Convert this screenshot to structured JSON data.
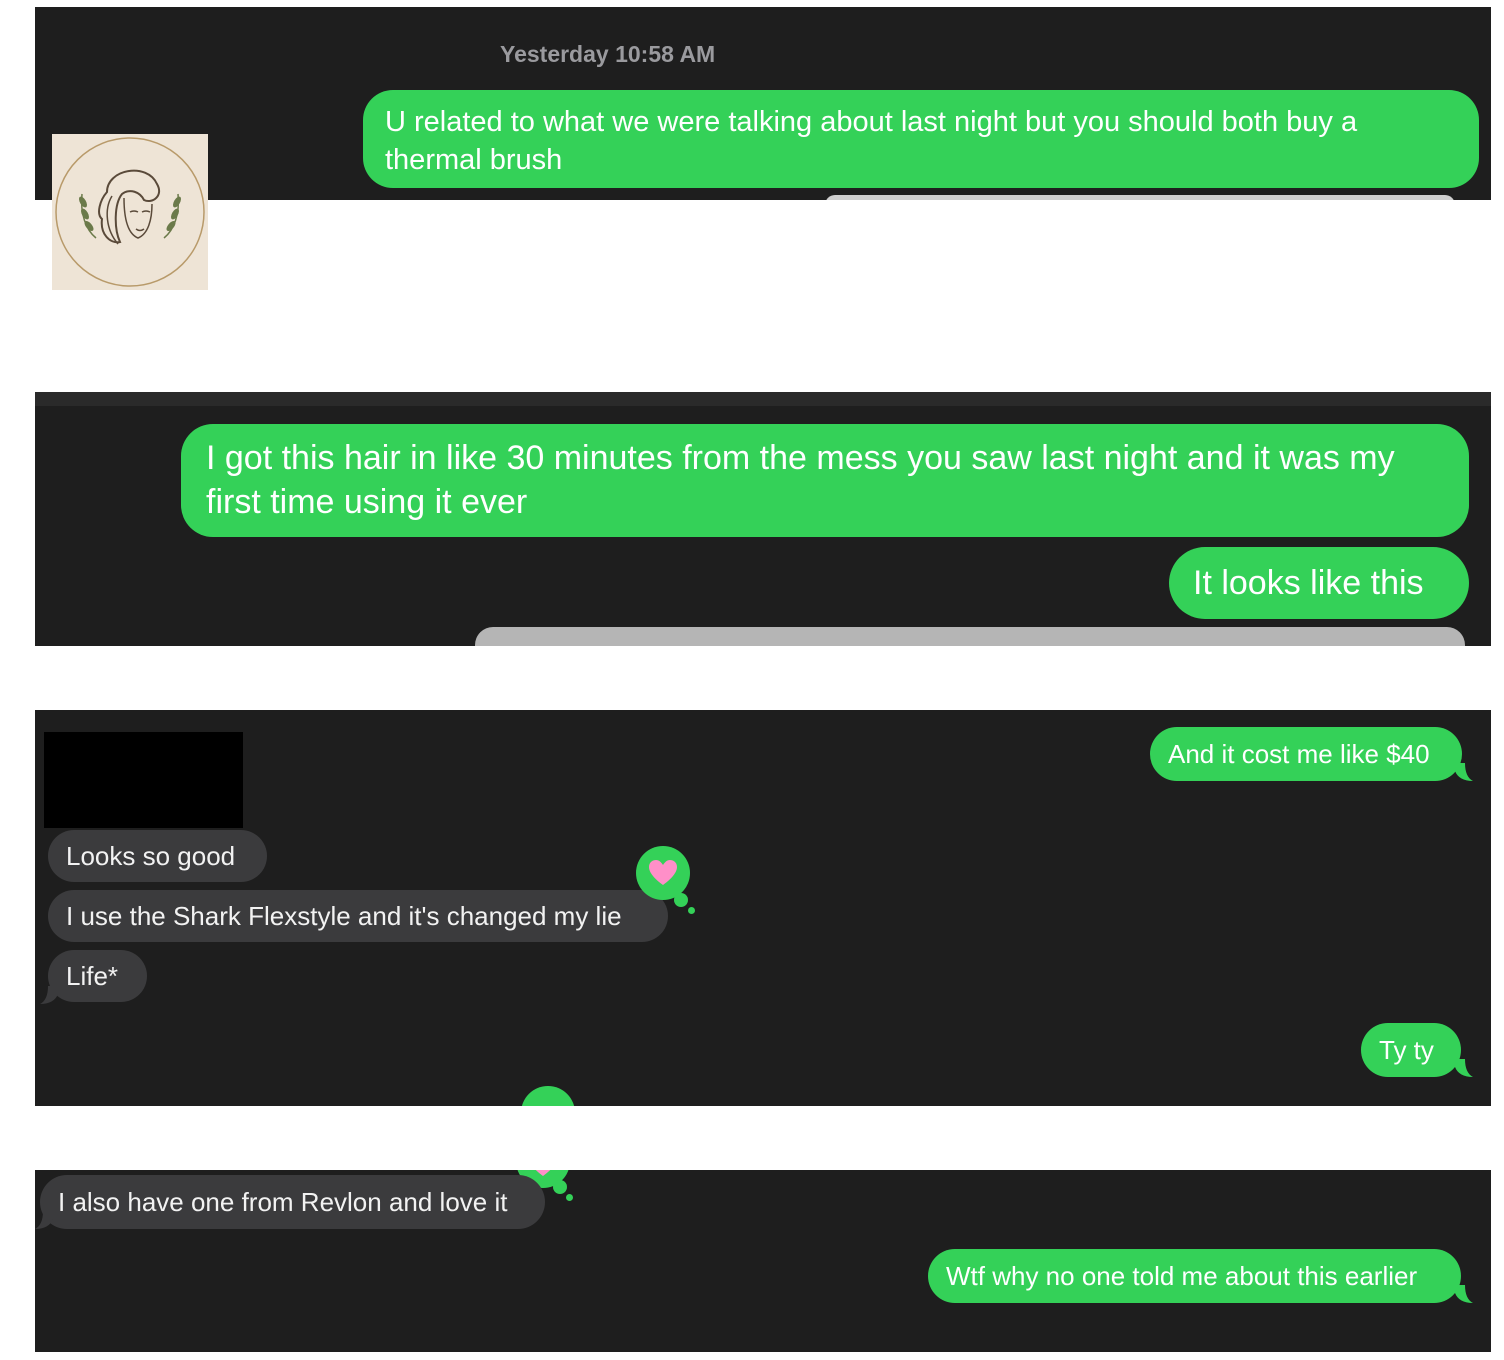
{
  "conversation": {
    "timestamp": "Yesterday 10:58 AM",
    "messages": [
      {
        "from": "me",
        "text": "U related to what we were talking about last night but you should both buy a thermal brush"
      },
      {
        "from": "me",
        "text": "I got this hair in like 30 minutes from the mess you saw last night and it was my first time using it ever"
      },
      {
        "from": "me",
        "text": "It looks like this"
      },
      {
        "from": "me",
        "text": "And it cost me like $40"
      },
      {
        "from": "them",
        "text": "Looks so good"
      },
      {
        "from": "them",
        "text": "I use the Shark Flexstyle and it's changed my lie"
      },
      {
        "from": "them",
        "text": "Life*"
      },
      {
        "from": "me",
        "text": "Ty ty"
      },
      {
        "from": "them",
        "text": "I also have one from Revlon and love it"
      },
      {
        "from": "me",
        "text": "Wtf why no one told me about this earlier"
      }
    ]
  },
  "colors": {
    "sent_bubble": "#34d158",
    "received_bubble": "#3b3b3d",
    "background": "#1e1e1e",
    "reaction_heart": "#ff8fc8"
  },
  "icons": [
    "woman-portrait-logo-icon",
    "heart-reaction-icon"
  ]
}
